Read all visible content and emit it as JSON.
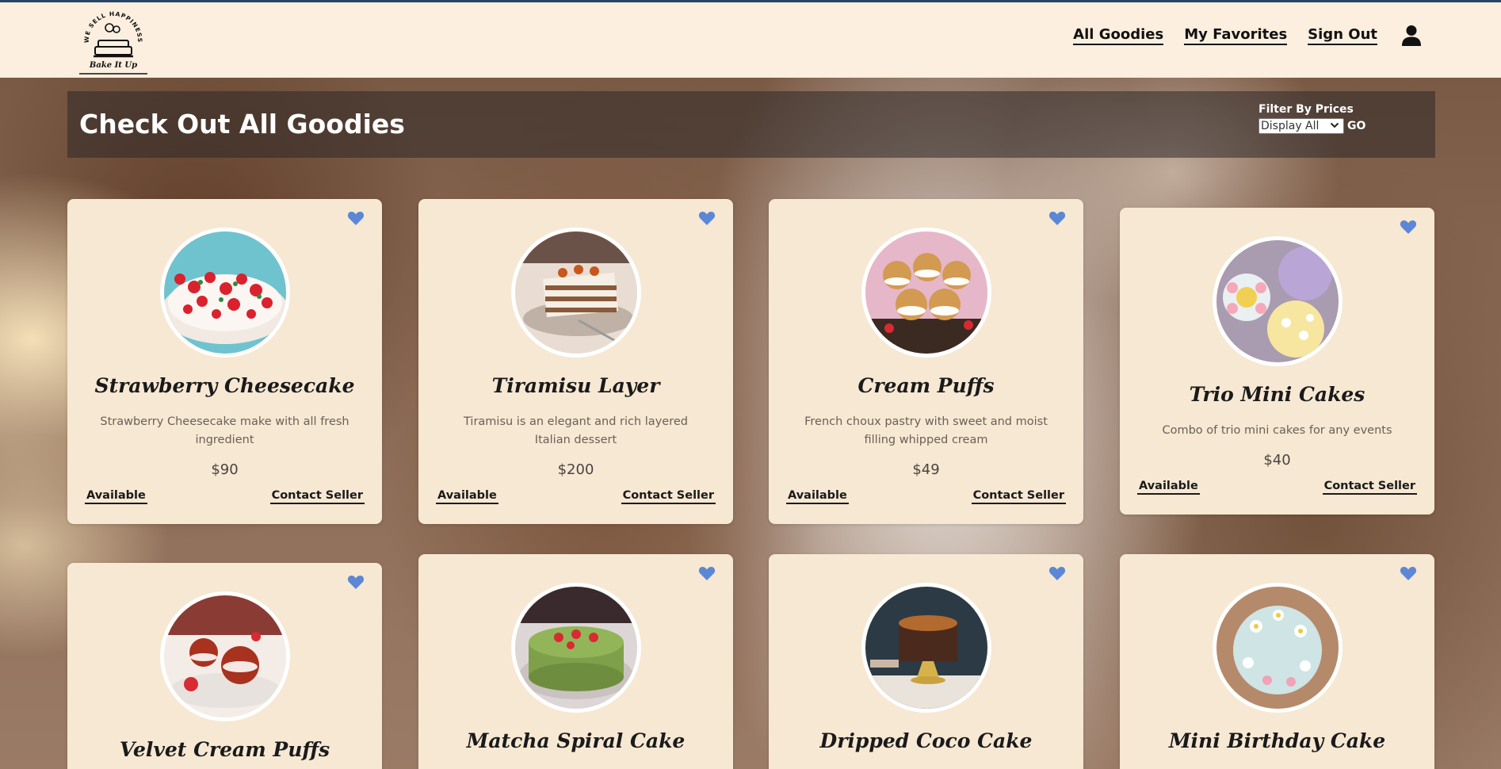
{
  "header": {
    "logo_top_text": "WE SELL HAPPINESS",
    "logo_bottom_text": "Bake It Up",
    "nav": [
      "All Goodies",
      "My Favorites",
      "Sign Out"
    ],
    "user_icon": "user-icon"
  },
  "banner": {
    "title": "Check Out All Goodies",
    "filter_label": "Filter By Prices",
    "filter_value": "Display All",
    "go_label": "GO"
  },
  "colors": {
    "heart": "#5b87d6",
    "card": "#f6e8d3",
    "banner": "#2d2828"
  },
  "products": [
    {
      "name": "Strawberry Cheesecake",
      "desc": "Strawberry Cheesecake make with all fresh ingredient",
      "price": "$90",
      "status": "Available",
      "contact": "Contact Seller",
      "favorite": "heart-icon"
    },
    {
      "name": "Tiramisu Layer",
      "desc": "Tiramisu is an elegant and rich layered Italian dessert",
      "price": "$200",
      "status": "Available",
      "contact": "Contact Seller",
      "favorite": "heart-icon"
    },
    {
      "name": "Cream Puffs",
      "desc": "French choux pastry with sweet and moist filling whipped cream",
      "price": "$49",
      "status": "Available",
      "contact": "Contact Seller",
      "favorite": "heart-icon"
    },
    {
      "name": "Trio Mini Cakes",
      "desc": "Combo of trio mini cakes for any events",
      "price": "$40",
      "status": "Available",
      "contact": "Contact Seller",
      "favorite": "heart-icon"
    },
    {
      "name": "Velvet Cream Puffs",
      "favorite": "heart-icon"
    },
    {
      "name": "Matcha Spiral Cake",
      "favorite": "heart-icon"
    },
    {
      "name": "Dripped Coco Cake",
      "favorite": "heart-icon"
    },
    {
      "name": "Mini Birthday Cake",
      "favorite": "heart-icon"
    }
  ]
}
